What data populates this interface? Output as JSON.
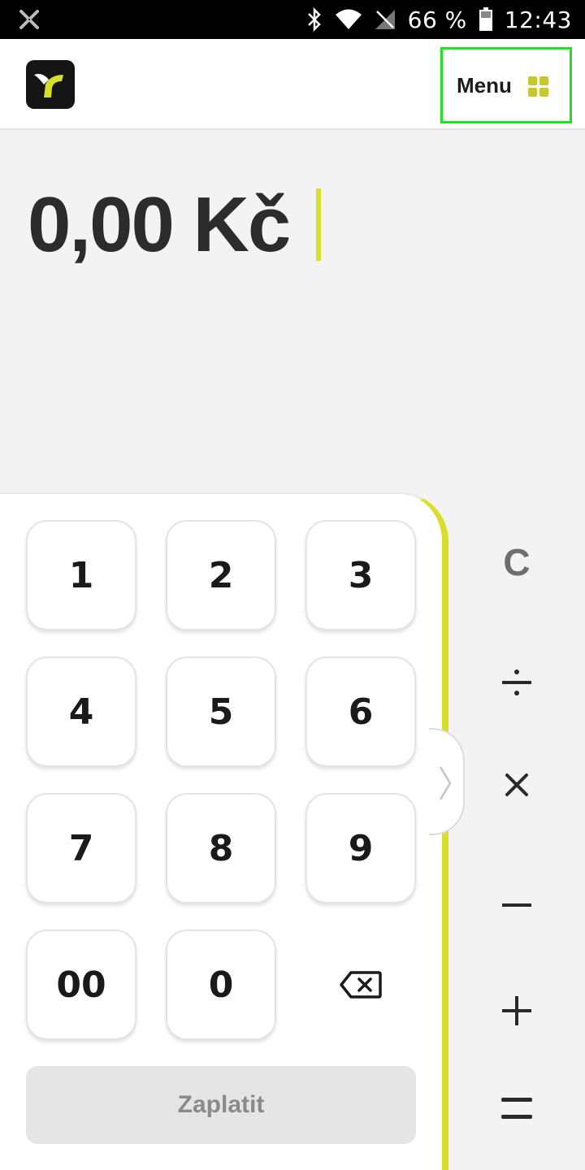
{
  "status_bar": {
    "battery_percent": "66 %",
    "time": "12:43",
    "icons": [
      "app-notification-icon",
      "bluetooth-icon",
      "wifi-icon",
      "no-signal-icon",
      "battery-icon"
    ]
  },
  "header": {
    "logo": "app-logo",
    "menu_label": "Menu",
    "menu_icon": "grid-icon"
  },
  "display": {
    "amount": "0,00 Kč"
  },
  "keypad": {
    "keys": [
      "1",
      "2",
      "3",
      "4",
      "5",
      "6",
      "7",
      "8",
      "9",
      "00",
      "0"
    ],
    "backspace_icon": "backspace-icon",
    "pay_label": "Zaplatit"
  },
  "operators": {
    "clear": "C",
    "icons": [
      "divide-icon",
      "multiply-icon",
      "minus-icon",
      "plus-icon",
      "equals-icon"
    ]
  },
  "colors": {
    "accent": "#d8df2b",
    "menu_highlight": "#1ee31e",
    "logo_bg": "#151515",
    "text_dark": "#2c2c2c",
    "pay_disabled_bg": "#e5e5e5"
  }
}
